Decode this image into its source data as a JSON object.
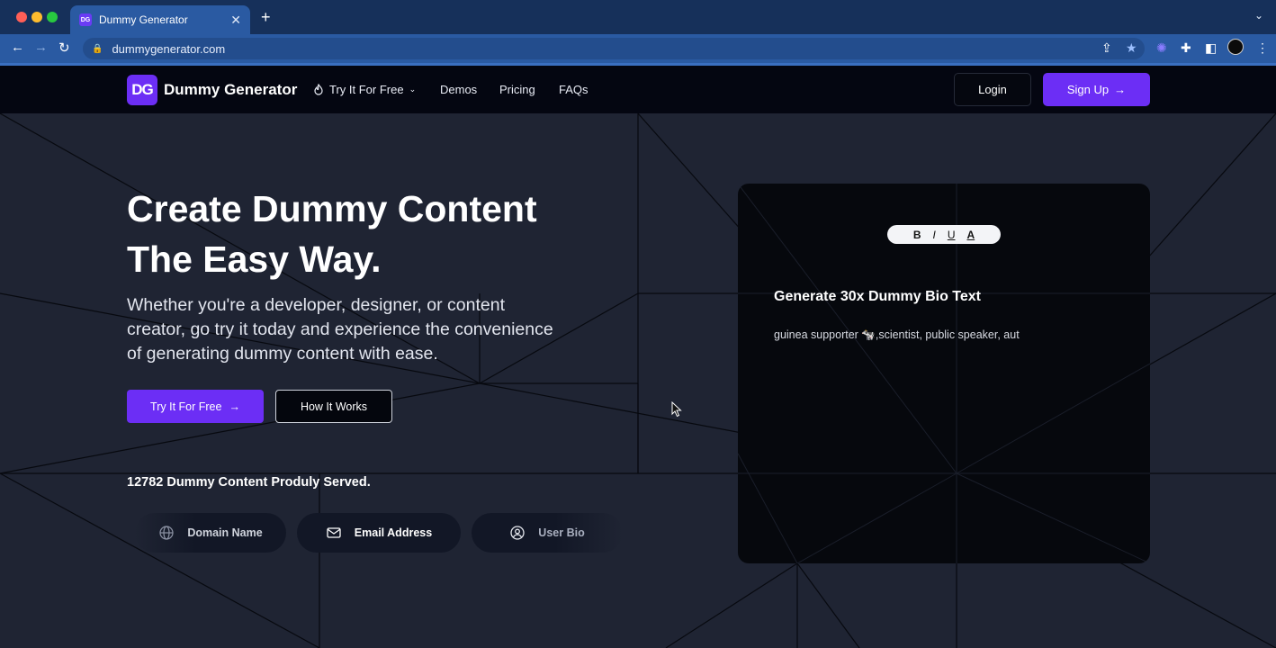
{
  "browser": {
    "tab_title": "Dummy Generator",
    "tab_favicon": "DG",
    "url": "dummygenerator.com",
    "colors": {
      "frame": "#16305a",
      "toolbar": "#2a5aa2"
    }
  },
  "header": {
    "logo_mark": "DG",
    "logo_text": "Dummy Generator",
    "nav": {
      "try": "Try It For Free",
      "demos": "Demos",
      "pricing": "Pricing",
      "faqs": "FAQs"
    },
    "login": "Login",
    "signup": "Sign Up"
  },
  "hero": {
    "title_line1": "Create Dummy Content",
    "title_line2": "The Easy Way.",
    "sub_line1": "Whether you're a developer, designer, or content",
    "sub_line2": "creator, go try it today and experience the convenience",
    "sub_line3": "of generating dummy content with ease.",
    "try_btn": "Try It For Free",
    "how_btn": "How It Works",
    "served": "12782 Dummy Content Produly Served.",
    "chips": {
      "domain": "Domain Name",
      "email": "Email Address",
      "bio": "User Bio"
    }
  },
  "card": {
    "toolbar": {
      "bold": "B",
      "italic": "I",
      "underline": "U",
      "color": "A"
    },
    "title": "Generate 30x Dummy Bio Text",
    "text": "guinea supporter 🐄,scientist, public speaker, aut"
  },
  "colors": {
    "accent": "#6c2ef5",
    "page_bg": "#1f2433",
    "header_bg": "#040611"
  }
}
